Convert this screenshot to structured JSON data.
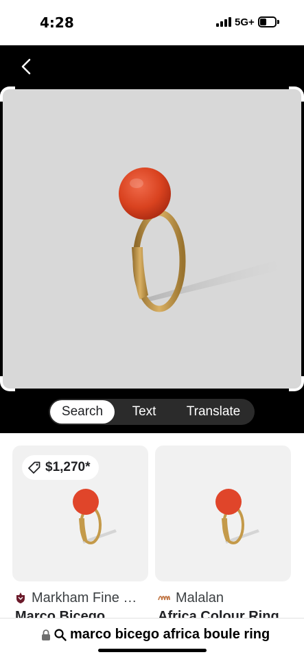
{
  "status_bar": {
    "time": "4:28",
    "network": "5G+"
  },
  "viewer": {
    "tabs": [
      {
        "label": "Search",
        "active": true
      },
      {
        "label": "Text",
        "active": false
      },
      {
        "label": "Translate",
        "active": false
      }
    ],
    "frame_color": "#d8d8d8"
  },
  "results": {
    "cards": [
      {
        "price": "$1,270*",
        "source": "Markham Fine …",
        "title": "Marco Bicego"
      },
      {
        "source": "Malalan",
        "title": "Africa Colour Ring"
      }
    ]
  },
  "bottom_bar": {
    "query": "marco bicego africa boule ring"
  },
  "colors": {
    "ring_stone": "#e0452a",
    "ring_band": "#c49a4a",
    "accent_dark": "#000000"
  }
}
